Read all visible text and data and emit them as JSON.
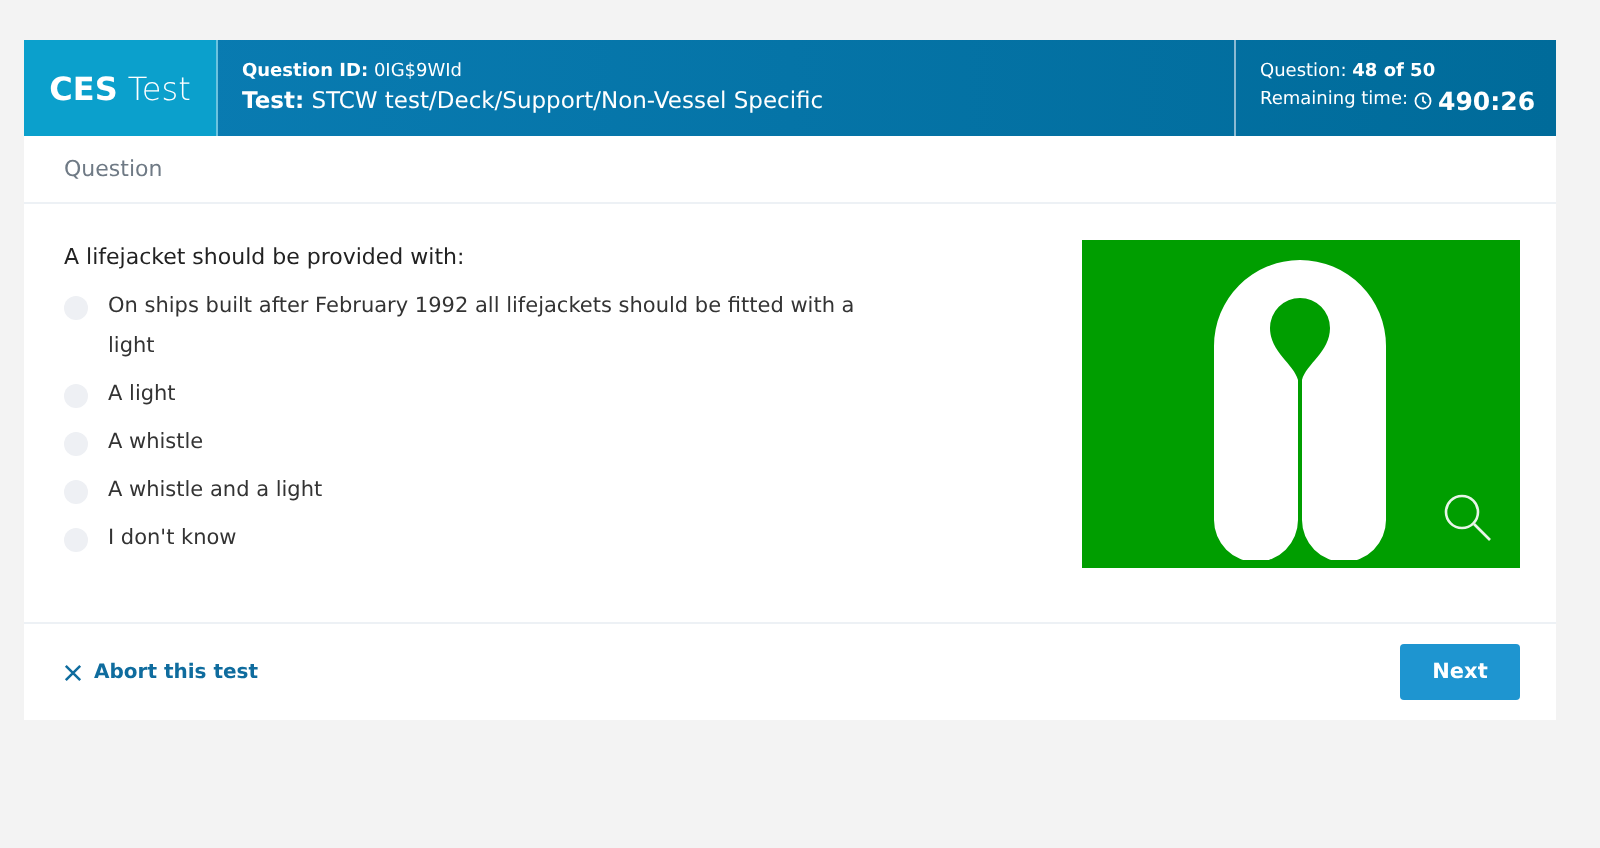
{
  "header": {
    "brand_bold": "CES",
    "brand_light": "Test",
    "question_id_label": "Question ID:",
    "question_id": "0IG$9WId",
    "test_label": "Test:",
    "test_path": "STCW test/Deck/Support/Non-Vessel Specific",
    "progress_label": "Question:",
    "progress": "48 of 50",
    "time_label": "Remaining time:",
    "time": "490:26"
  },
  "section_title": "Question",
  "question": "A lifejacket should be provided with:",
  "answers": [
    {
      "label": "On ships built after February 1992 all lifejackets should be fitted with a light",
      "selected": false
    },
    {
      "label": "A light",
      "selected": false
    },
    {
      "label": "A whistle",
      "selected": false
    },
    {
      "label": "A whistle and a light",
      "selected": false
    },
    {
      "label": "I don't know",
      "selected": false
    }
  ],
  "footer": {
    "abort": "Abort this test",
    "next": "Next"
  }
}
